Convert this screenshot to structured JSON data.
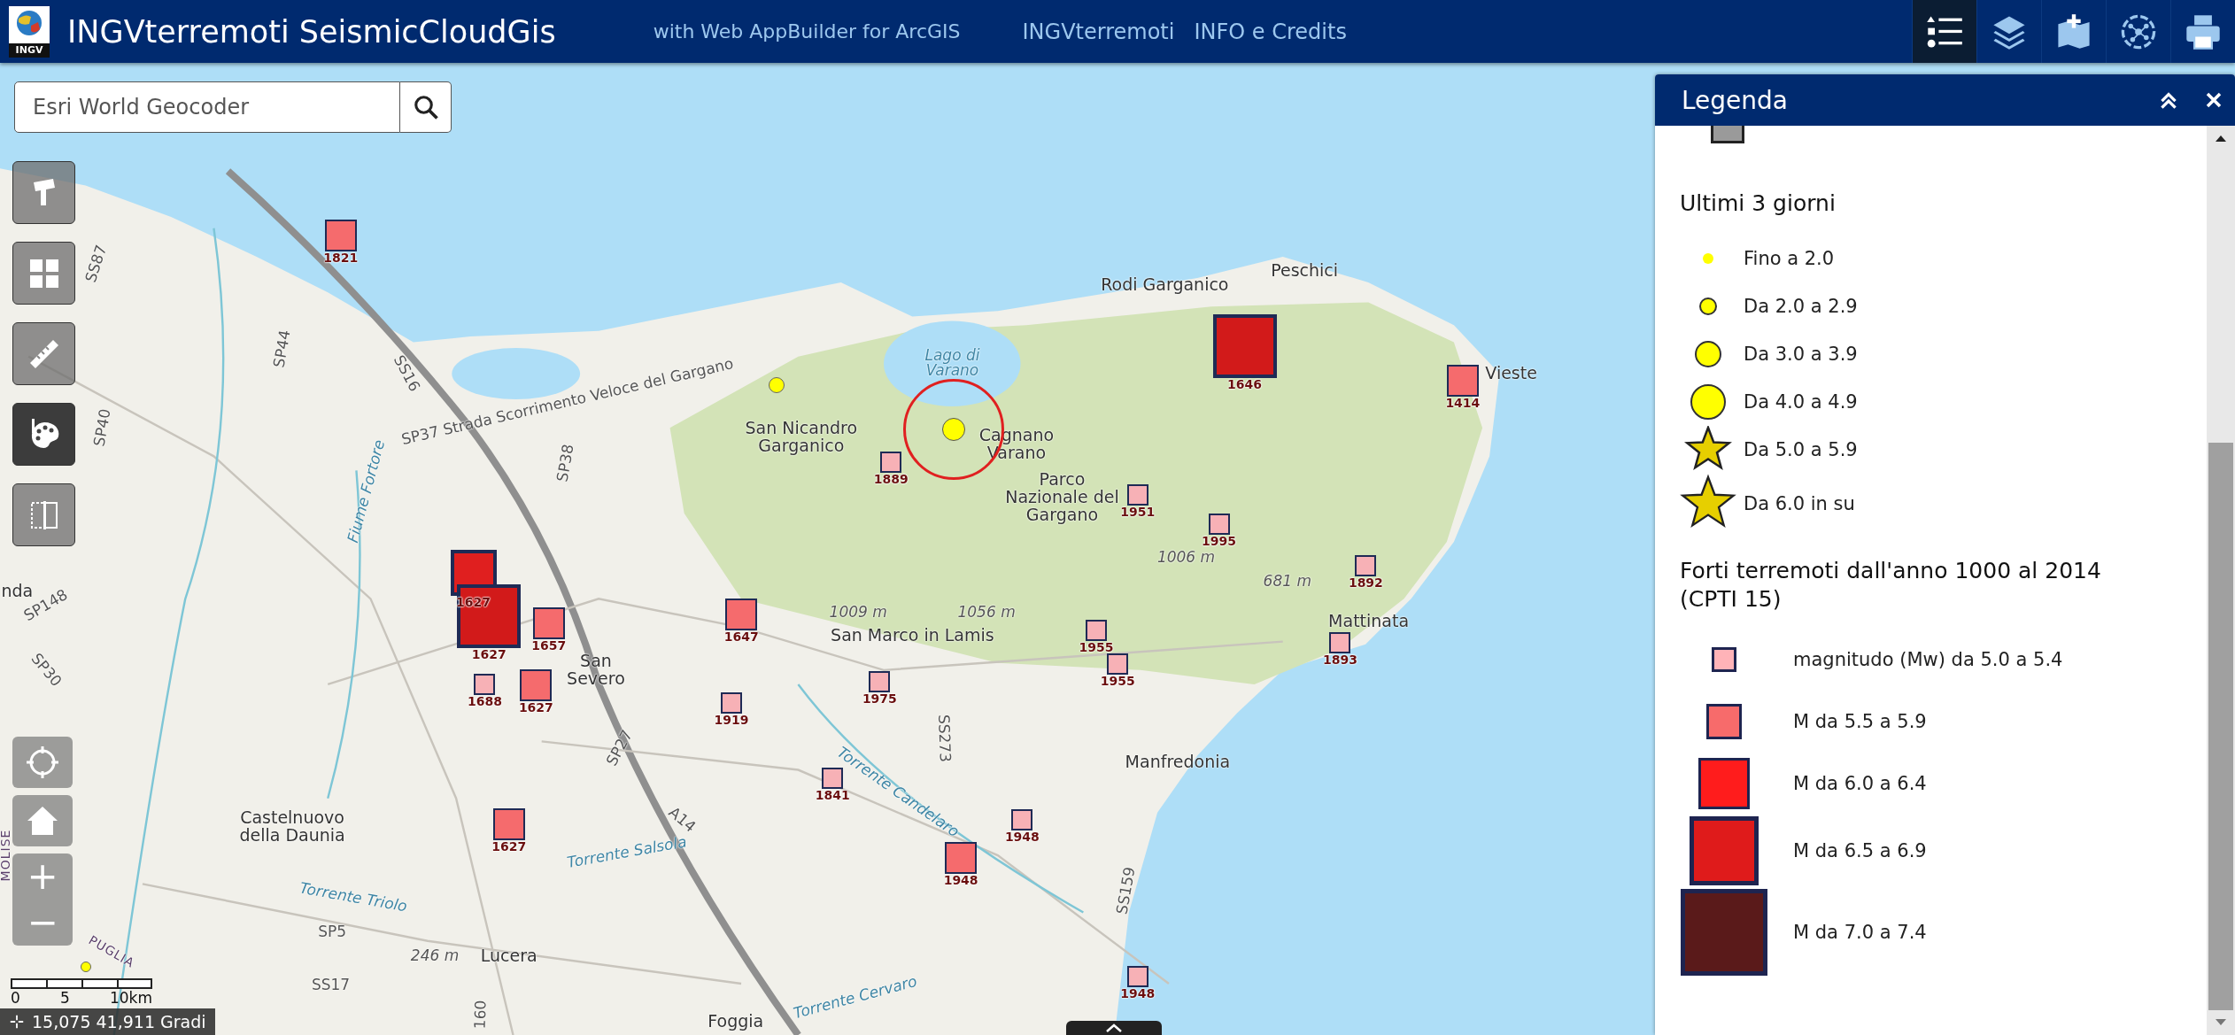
{
  "header": {
    "logo_text": "INGV",
    "title": "INGVterremoti SeismicCloudGis",
    "subtitle": "with Web AppBuilder for ArcGIS",
    "links": [
      "INGVterremoti",
      "INFO e Credits"
    ],
    "tools": [
      {
        "kind": "legend",
        "selected": true
      },
      {
        "kind": "layers",
        "selected": false
      },
      {
        "kind": "add-data",
        "selected": false
      },
      {
        "kind": "analysis",
        "selected": false
      },
      {
        "kind": "print",
        "selected": false
      }
    ]
  },
  "search": {
    "placeholder": "Esri World Geocoder"
  },
  "map_tools": [
    {
      "kind": "pointer",
      "selected": false
    },
    {
      "kind": "grid",
      "selected": false
    },
    {
      "kind": "ruler",
      "selected": false
    },
    {
      "kind": "palette",
      "selected": true
    },
    {
      "kind": "swipe",
      "selected": false
    }
  ],
  "map_controls": {
    "zoom_in": "+",
    "zoom_out": "−"
  },
  "map_labels": [
    {
      "kind": "place",
      "text": "Peschici"
    },
    {
      "kind": "place",
      "text": "Rodi Garganico"
    },
    {
      "kind": "place",
      "text": "Vieste"
    },
    {
      "kind": "water",
      "text": "Lago di Varano"
    },
    {
      "kind": "place",
      "text": "San Nicandro Garganico"
    },
    {
      "kind": "place",
      "text": "Cagnano Varano"
    },
    {
      "kind": "place",
      "text": "Parco Nazionale del Gargano"
    },
    {
      "kind": "elevation",
      "text": "1006 m"
    },
    {
      "kind": "elevation",
      "text": "681 m"
    },
    {
      "kind": "elevation",
      "text": "1009 m"
    },
    {
      "kind": "elevation",
      "text": "1056 m"
    },
    {
      "kind": "place",
      "text": "San Marco in Lamis"
    },
    {
      "kind": "place",
      "text": "Mattinata"
    },
    {
      "kind": "place",
      "text": "Manfredonia"
    },
    {
      "kind": "place",
      "text": "San Severo"
    },
    {
      "kind": "place",
      "text": "Castelnuovo della Daunia"
    },
    {
      "kind": "place",
      "text": "Lucera"
    },
    {
      "kind": "place",
      "text": "Foggia"
    },
    {
      "kind": "road",
      "text": "SP37 Strada Scorrimento Veloce del Gargano"
    },
    {
      "kind": "road",
      "text": "SS273"
    },
    {
      "kind": "road",
      "text": "SS16"
    },
    {
      "kind": "road",
      "text": "SP44"
    },
    {
      "kind": "road",
      "text": "SP40"
    },
    {
      "kind": "road",
      "text": "SS87"
    },
    {
      "kind": "road",
      "text": "SP38"
    },
    {
      "kind": "road",
      "text": "SP30"
    },
    {
      "kind": "road",
      "text": "SP27"
    },
    {
      "kind": "road",
      "text": "A14"
    },
    {
      "kind": "road",
      "text": "SP148"
    },
    {
      "kind": "road",
      "text": "SP5"
    },
    {
      "kind": "road",
      "text": "SS17"
    },
    {
      "kind": "road",
      "text": "SS159"
    },
    {
      "kind": "water",
      "text": "Torrente Candelaro"
    },
    {
      "kind": "water",
      "text": "Torrente Salsola"
    },
    {
      "kind": "water",
      "text": "Torrente Triolo"
    },
    {
      "kind": "water",
      "text": "Torrente Cervaro"
    },
    {
      "kind": "water",
      "text": "Fiume Fortore"
    },
    {
      "kind": "place",
      "text": "nda"
    },
    {
      "kind": "region",
      "text": "PUGLIA"
    },
    {
      "kind": "region",
      "text": "MOLISE"
    },
    {
      "kind": "elevation",
      "text": "246 m"
    },
    {
      "kind": "road",
      "text": "160"
    }
  ],
  "historic_quakes": [
    {
      "year": "1821",
      "kind": "medium",
      "color": "#f56b6d"
    },
    {
      "year": "1646",
      "kind": "xlarge",
      "color": "#d21a1a"
    },
    {
      "year": "1414",
      "kind": "medium",
      "color": "#f56b6d"
    },
    {
      "year": "1889",
      "kind": "small",
      "color": "#f7b1b6"
    },
    {
      "year": "1951",
      "kind": "small",
      "color": "#f7b1b6"
    },
    {
      "year": "1995",
      "kind": "small",
      "color": "#f7b1b6"
    },
    {
      "year": "1892",
      "kind": "small",
      "color": "#f7b1b6"
    },
    {
      "year": "1627",
      "kind": "large",
      "color": "#e01f1f"
    },
    {
      "year": "1627",
      "kind": "xlarge",
      "color": "#d21a1a"
    },
    {
      "year": "1657",
      "kind": "medium",
      "color": "#f56b6d"
    },
    {
      "year": "1647",
      "kind": "medium",
      "color": "#f56b6d"
    },
    {
      "year": "1955",
      "kind": "small",
      "color": "#f7b1b6"
    },
    {
      "year": "1893",
      "kind": "small",
      "color": "#f7b1b6"
    },
    {
      "year": "1955",
      "kind": "small",
      "color": "#f7b1b6"
    },
    {
      "year": "1975",
      "kind": "small",
      "color": "#f7b1b6"
    },
    {
      "year": "1688",
      "kind": "small",
      "color": "#f7b1b6"
    },
    {
      "year": "1627",
      "kind": "medium",
      "color": "#f56b6d"
    },
    {
      "year": "1919",
      "kind": "small",
      "color": "#f7b1b6"
    },
    {
      "year": "1841",
      "kind": "small",
      "color": "#f7b1b6"
    },
    {
      "year": "1627",
      "kind": "medium",
      "color": "#f56b6d"
    },
    {
      "year": "1948",
      "kind": "small",
      "color": "#f7b1b6"
    },
    {
      "year": "1948",
      "kind": "medium",
      "color": "#f56b6d"
    },
    {
      "year": "1948",
      "kind": "small",
      "color": "#f7b1b6"
    }
  ],
  "recent_quakes": [
    {
      "kind": "small",
      "highlighted": false
    },
    {
      "kind": "medium",
      "highlighted": true
    },
    {
      "kind": "tiny",
      "highlighted": false
    }
  ],
  "scale_bar": {
    "labels": [
      "0",
      "5",
      "10km"
    ]
  },
  "coordinates": "15,075 41,911 Gradi",
  "legend": {
    "title": "Legenda",
    "sections": [
      {
        "title": "Ultimi 3 giorni",
        "items": [
          {
            "kind": "circle",
            "label": "Fino a 2.0",
            "color": "#ffff00"
          },
          {
            "kind": "circle",
            "label": "Da 2.0 a 2.9",
            "color": "#ffff00"
          },
          {
            "kind": "circle",
            "label": "Da 3.0 a 3.9",
            "color": "#ffff00"
          },
          {
            "kind": "circle",
            "label": "Da 4.0 a 4.9",
            "color": "#ffff00"
          },
          {
            "kind": "star",
            "label": "Da 5.0 a 5.9",
            "color": "#e6cf00"
          },
          {
            "kind": "star",
            "label": "Da 6.0 in su",
            "color": "#e6cf00"
          }
        ]
      },
      {
        "title": "Forti terremoti dall'anno 1000 al 2014 (CPTI 15)",
        "items": [
          {
            "kind": "square",
            "label": "magnitudo (Mw) da 5.0 a 5.4",
            "color": "#ffb3b8"
          },
          {
            "kind": "square",
            "label": "M da 5.5 a 5.9",
            "color": "#f76b6b"
          },
          {
            "kind": "square",
            "label": "M da 6.0 a 6.4",
            "color": "#ff1c1c"
          },
          {
            "kind": "square",
            "label": "M da 6.5 a 6.9",
            "color": "#df1b1b"
          },
          {
            "kind": "square",
            "label": "M da 7.0 a 7.4",
            "color": "#5a1a1a"
          }
        ]
      }
    ]
  }
}
